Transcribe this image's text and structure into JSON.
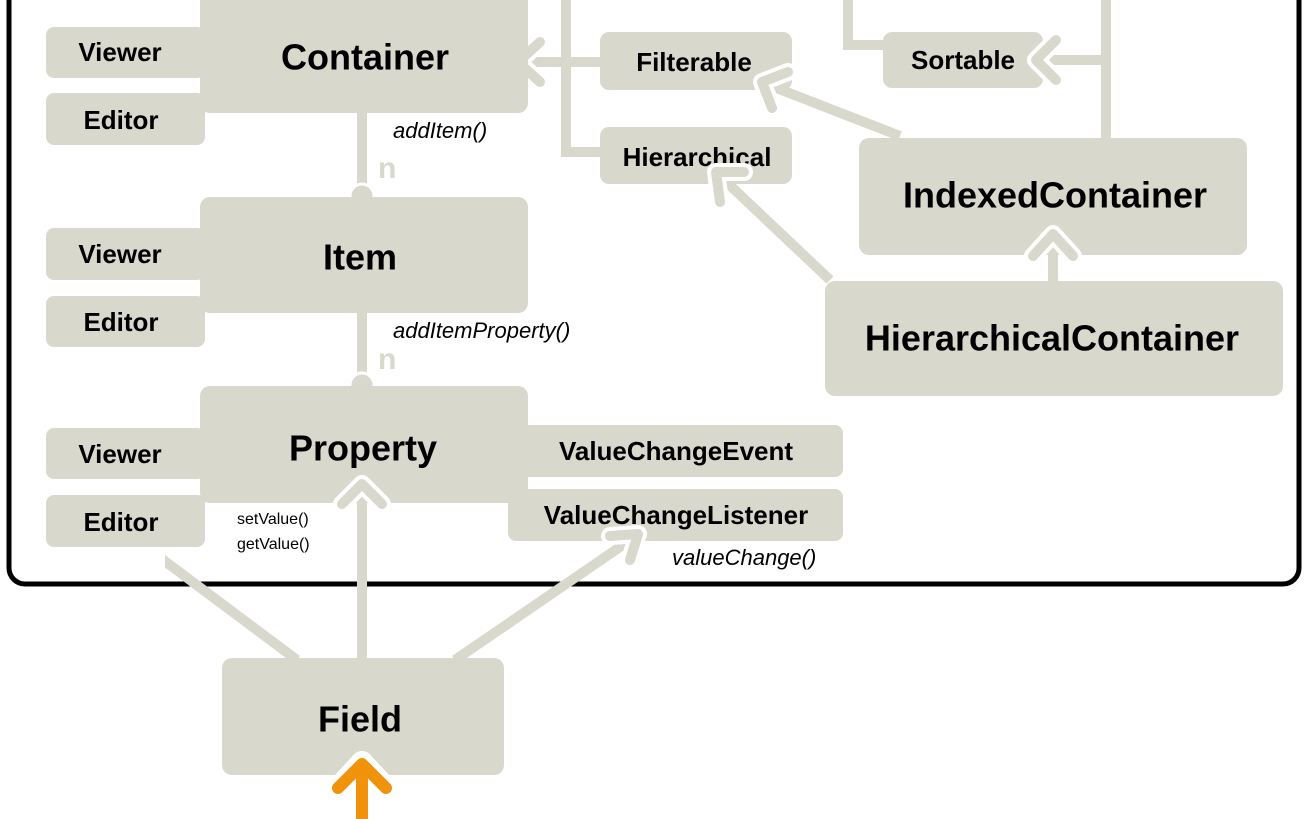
{
  "colors": {
    "box": "#d9d8cd",
    "line": "#d9d8cd",
    "frame": "#000000",
    "highlight_arrow": "#f0930a"
  },
  "nodes": {
    "container": "Container",
    "item": "Item",
    "property": "Property",
    "viewer": "Viewer",
    "editor": "Editor",
    "filterable": "Filterable",
    "hierarchical": "Hierarchical",
    "sortable": "Sortable",
    "indexed_container": "IndexedContainer",
    "hierarchical_container": "HierarchicalContainer",
    "value_change_event": "ValueChangeEvent",
    "value_change_listener": "ValueChangeListener",
    "field": "Field"
  },
  "labels": {
    "add_item": "addItem()",
    "add_item_property": "addItemProperty()",
    "set_value": "setValue()",
    "get_value": "getValue()",
    "value_change": "valueChange()",
    "multiplicity_item": "n",
    "multiplicity_property": "n"
  }
}
